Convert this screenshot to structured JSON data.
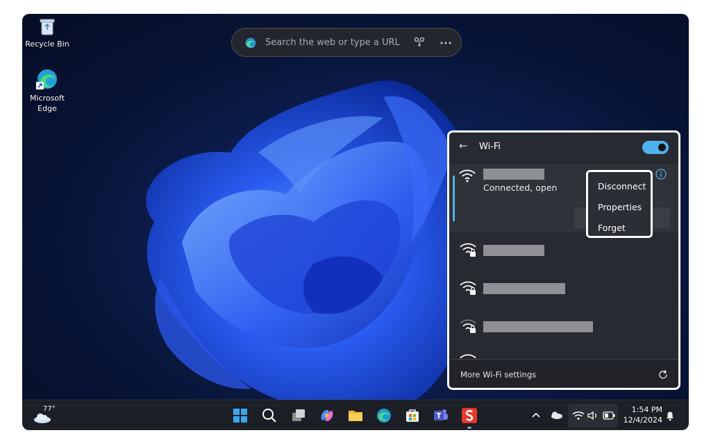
{
  "desktop": {
    "icons": [
      {
        "label": "Recycle Bin"
      },
      {
        "label": "Microsoft Edge"
      }
    ]
  },
  "searchbar": {
    "placeholder": "Search the web or type a URL",
    "icons": [
      "edge-icon",
      "visual-search-icon",
      "more-icon"
    ]
  },
  "wifi_panel": {
    "title": "Wi-Fi",
    "toggle_on": true,
    "accent": "#4fb2ee",
    "connected_network": {
      "name": "",
      "status": "Connected, open"
    },
    "context_menu": {
      "items": [
        "Disconnect",
        "Properties",
        "Forget"
      ]
    },
    "networks": [
      {
        "secured": true
      },
      {
        "secured": true
      },
      {
        "secured": true
      },
      {
        "secured": false
      }
    ],
    "footer_link": "More Wi-Fi settings"
  },
  "taskbar": {
    "weather_temp": "77°",
    "apps": [
      "start-icon",
      "search-icon",
      "task-view-icon",
      "copilot-icon",
      "file-explorer-icon",
      "edge-icon",
      "store-icon",
      "teams-icon",
      "snagit-icon"
    ],
    "tray_icons": [
      "chevron-up-icon",
      "onedrive-icon",
      "wifi-icon",
      "volume-icon",
      "battery-icon",
      "bell-icon"
    ],
    "time": "1:54 PM",
    "date": "12/4/2024"
  }
}
